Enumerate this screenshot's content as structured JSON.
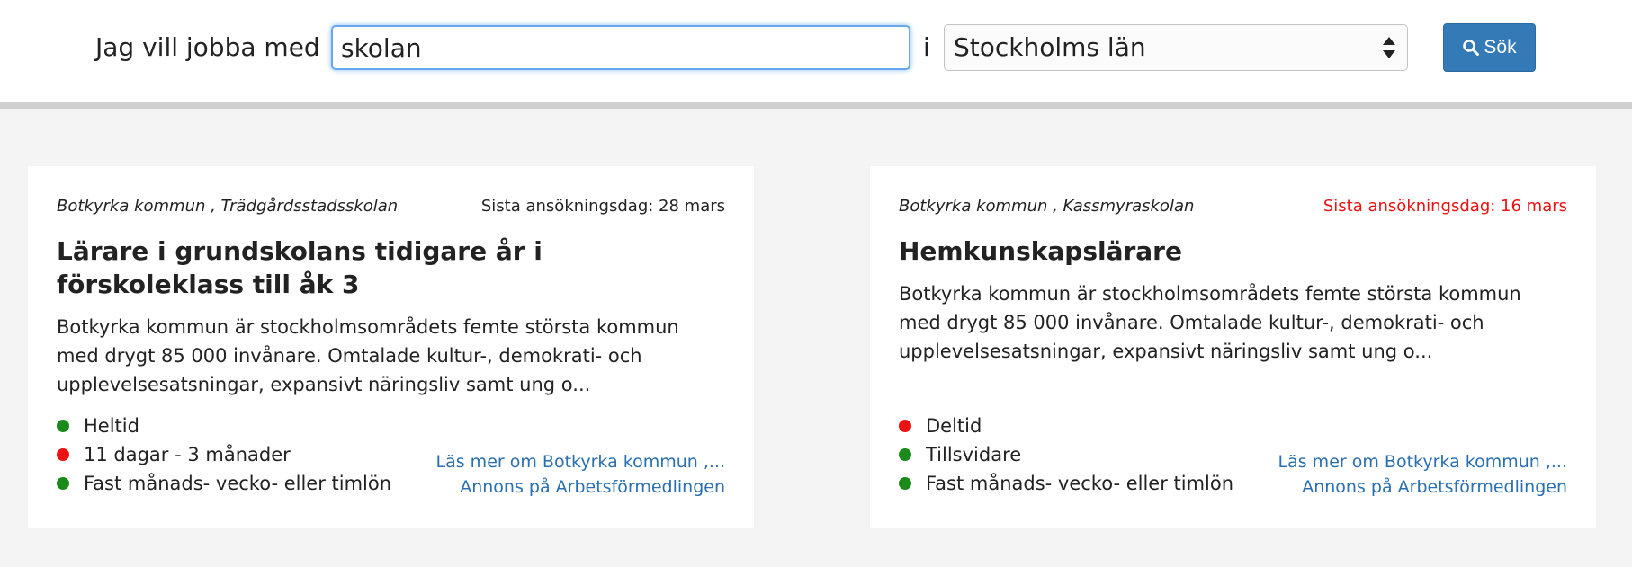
{
  "search": {
    "lead_text": "Jag vill jobba med",
    "query": "skolan",
    "conjunction": "i",
    "region": "Stockholms län",
    "button_label": "Sök"
  },
  "colors": {
    "accent": "#337ab7",
    "link": "#2a6fb0",
    "urgent": "#ee1111",
    "status_green": "#1a8a1a",
    "status_red": "#ee1111"
  },
  "cards": [
    {
      "employer": "Botkyrka kommun , Trädgårdsstadsskolan",
      "deadline": "Sista ansökningsdag: 28 mars",
      "deadline_urgent": false,
      "title": "Lärare i grundskolans tidigare år i förskoleklass till åk 3",
      "description": "Botkyrka kommun är stockholmsområdets femte största kommun med drygt 85 000 invånare. Omtalade kultur-, demokrati- och upplevelsesatsningar, expansivt näringsliv samt ung o...",
      "attributes": [
        {
          "label": "Heltid",
          "status": "green"
        },
        {
          "label": "11 dagar - 3 månader",
          "status": "red"
        },
        {
          "label": "Fast månads- vecko- eller timlön",
          "status": "green"
        }
      ],
      "more_link": "Läs mer om Botkyrka kommun ,...",
      "ad_link": "Annons på Arbetsförmedlingen"
    },
    {
      "employer": "Botkyrka kommun , Kassmyraskolan",
      "deadline": "Sista ansökningsdag: 16 mars",
      "deadline_urgent": true,
      "title": "Hemkunskapslärare",
      "description": "Botkyrka kommun är stockholmsområdets femte största kommun med drygt 85 000 invånare. Omtalade kultur-, demokrati- och upplevelsesatsningar, expansivt näringsliv samt ung o...",
      "attributes": [
        {
          "label": "Deltid",
          "status": "red"
        },
        {
          "label": "Tillsvidare",
          "status": "green"
        },
        {
          "label": "Fast månads- vecko- eller timlön",
          "status": "green"
        }
      ],
      "more_link": "Läs mer om Botkyrka kommun ,...",
      "ad_link": "Annons på Arbetsförmedlingen"
    }
  ]
}
